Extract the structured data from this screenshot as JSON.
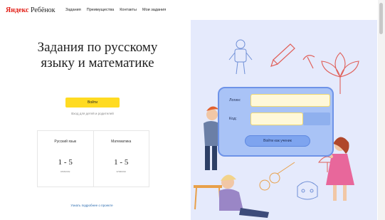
{
  "header": {
    "logo_brand": "Яндекс",
    "logo_product": "Ребёнок",
    "nav": [
      "Задания",
      "Преимущества",
      "Контакты",
      "Мои задания"
    ]
  },
  "main": {
    "title": "Задания по русскому языку и математике",
    "login_button": "Войти",
    "sub_link": "Вход для детей и родителей",
    "subjects": [
      {
        "name": "Русский язык",
        "grade": "1 - 5",
        "unit": "классы"
      },
      {
        "name": "Математика",
        "grade": "1 - 5",
        "unit": "классы"
      }
    ],
    "bottom_link": "Узнать подробнее о проекте"
  },
  "login_panel": {
    "login_label": "Логин:",
    "code_label": "Код:",
    "submit": "Войти как ученик"
  },
  "colors": {
    "accent": "#ffdb22",
    "panel": "#a9c3f6",
    "illustration_bg": "#e5eafc"
  }
}
